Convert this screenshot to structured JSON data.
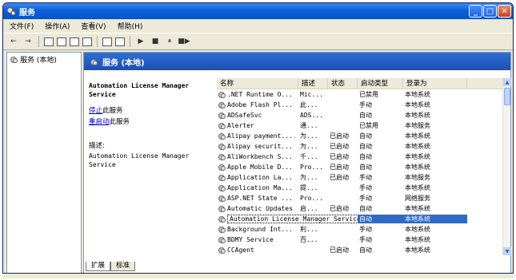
{
  "window": {
    "title": "服务",
    "min": "_",
    "max": "□",
    "close": "✕"
  },
  "menu": [
    "文件(F)",
    "操作(A)",
    "查看(V)",
    "帮助(H)"
  ],
  "toolbar": {
    "back": "←",
    "forward": "→",
    "play": "▶",
    "stop": "■",
    "pause": "⏸",
    "restart": "■▶"
  },
  "tree": {
    "root": "服务 (本地)"
  },
  "header": {
    "title": "服务 (本地)"
  },
  "detail": {
    "service_name": "Automation License Manager Service",
    "stop_link": "停止",
    "stop_rest": "此服务",
    "restart_link": "重启动",
    "restart_rest": "此服务",
    "desc_label": "描述:",
    "desc_text": "Automation License Manager Service"
  },
  "columns": [
    "名称",
    "描述",
    "状态",
    "启动类型",
    "登录为"
  ],
  "rows": [
    {
      "name": ".NET Runtime O...",
      "desc": "Mic...",
      "status": "",
      "start": "已禁用",
      "logon": "本地系统"
    },
    {
      "name": "Adobe Flash Pl...",
      "desc": "此...",
      "status": "",
      "start": "手动",
      "logon": "本地系统"
    },
    {
      "name": "ADSafeSvc",
      "desc": "ADS...",
      "status": "",
      "start": "自动",
      "logon": "本地系统"
    },
    {
      "name": "Alerter",
      "desc": "通...",
      "status": "",
      "start": "已禁用",
      "logon": "本地服务"
    },
    {
      "name": "Alipay payment...",
      "desc": "为...",
      "status": "已启动",
      "start": "自动",
      "logon": "本地系统"
    },
    {
      "name": "Alipay securit...",
      "desc": "为...",
      "status": "已启动",
      "start": "自动",
      "logon": "本地系统"
    },
    {
      "name": "AliWorkbench S...",
      "desc": "千...",
      "status": "已启动",
      "start": "自动",
      "logon": "本地系统"
    },
    {
      "name": "Apple Mobile D...",
      "desc": "Pro...",
      "status": "已启动",
      "start": "自动",
      "logon": "本地系统"
    },
    {
      "name": "Application La...",
      "desc": "为...",
      "status": "已启动",
      "start": "手动",
      "logon": "本地服务"
    },
    {
      "name": "Application Ma...",
      "desc": "提...",
      "status": "",
      "start": "手动",
      "logon": "本地系统"
    },
    {
      "name": "ASP.NET State ...",
      "desc": "Pro...",
      "status": "",
      "start": "手动",
      "logon": "网络服务"
    },
    {
      "name": "Automatic Updates",
      "desc": "启...",
      "status": "已启动",
      "start": "自动",
      "logon": "本地系统"
    },
    {
      "name": "Automation License Manager Service",
      "desc": "",
      "status": "",
      "start": "自动",
      "logon": "本地系统",
      "selected": true
    },
    {
      "name": "Background Int...",
      "desc": "利...",
      "status": "",
      "start": "手动",
      "logon": "本地系统"
    },
    {
      "name": "BDMY Service",
      "desc": "百...",
      "status": "",
      "start": "手动",
      "logon": "本地系统"
    },
    {
      "name": "CCAgent",
      "desc": "",
      "status": "已启动",
      "start": "自动",
      "logon": "本地系统"
    }
  ],
  "tabs": [
    "扩展",
    "标准"
  ]
}
